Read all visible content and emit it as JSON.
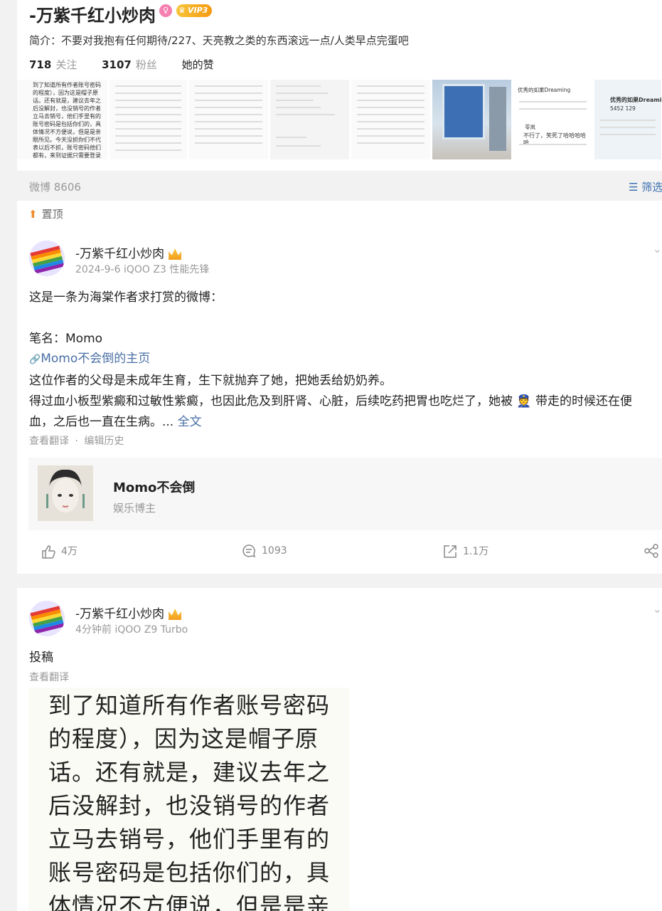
{
  "profile": {
    "name": "-万紫千红小炒肉",
    "vip": "VIP3",
    "intro": "简介：不要对我抱有任何期待/227、天亮教之类的东西滚远一点/人类早点完蛋吧",
    "following_count": "718",
    "following_label": "关注",
    "fans_count": "3107",
    "fans_label": "粉丝",
    "likes_label": "她的赞",
    "thumb1_text": "到了知道所有作者账号密码的程度），因为这是帽子原话。还有就是，建议去年之后没解封，也没销号的作者立马去销号，他们手里有的账号密码是包括你们的，具体情况不方便说，但是是亲眼所见。今天没抓你们不代表以后不抓，账号密码他们都有，来到证据只需要登录就可以了。",
    "thumb_preview_text": "优秀的如果Dreaming",
    "thumb_preview_name": "苓岚",
    "thumb_preview_comment": "不行了，笑死了哈哈哈哈哈",
    "thumb_last_title": "优秀的如果Dreaming",
    "thumb_last_stats": "5452  129"
  },
  "feed": {
    "count_label": "微博 8606",
    "filter_label": "筛选"
  },
  "post1": {
    "pinned_label": "置顶",
    "author": "-万紫千红小炒肉",
    "meta": "2024-9-6   iQOO Z3 性能先锋",
    "line1": "这是一条为海棠作者求打赏的微博：",
    "line2": "笔名：Momo",
    "link_text": "Momo不会倒的主页",
    "line3": "这位作者的父母是未成年生育，生下就抛弃了她，把她丢给奶奶养。",
    "line4": "得过血小板型紫癜和过敏性紫癜，也因此危及到肝肾、心脏，后续吃药把胃也吃烂了，她被 👮 带走的时候还在便",
    "line5": "血，之后也一直在生病。...",
    "full_text": "全文",
    "translate": "查看翻译",
    "dot": "·",
    "edit_history": "编辑历史",
    "cite_name": "Momo不会倒",
    "cite_sub": "娱乐博主",
    "likes": "4万",
    "comments": "1093",
    "reposts": "1.1万"
  },
  "post2": {
    "author": "-万紫千红小炒肉",
    "meta": "4分钟前   iQOO Z9 Turbo",
    "text": "投稿",
    "translate": "查看翻译",
    "image_lines": [
      "到了知道所有作者账号密码",
      "的程度），因为这是帽子原",
      "话。还有就是，建议去年之",
      "后没解封，也没销号的作者",
      "立马去销号，他们手里有的",
      "账号密码是包括你们的，具",
      "体情况不方便说，但是是亲"
    ]
  },
  "colors": {
    "link": "#4a6fa5",
    "vip_gold": "#f59a12",
    "background": "#f2f2f2"
  }
}
